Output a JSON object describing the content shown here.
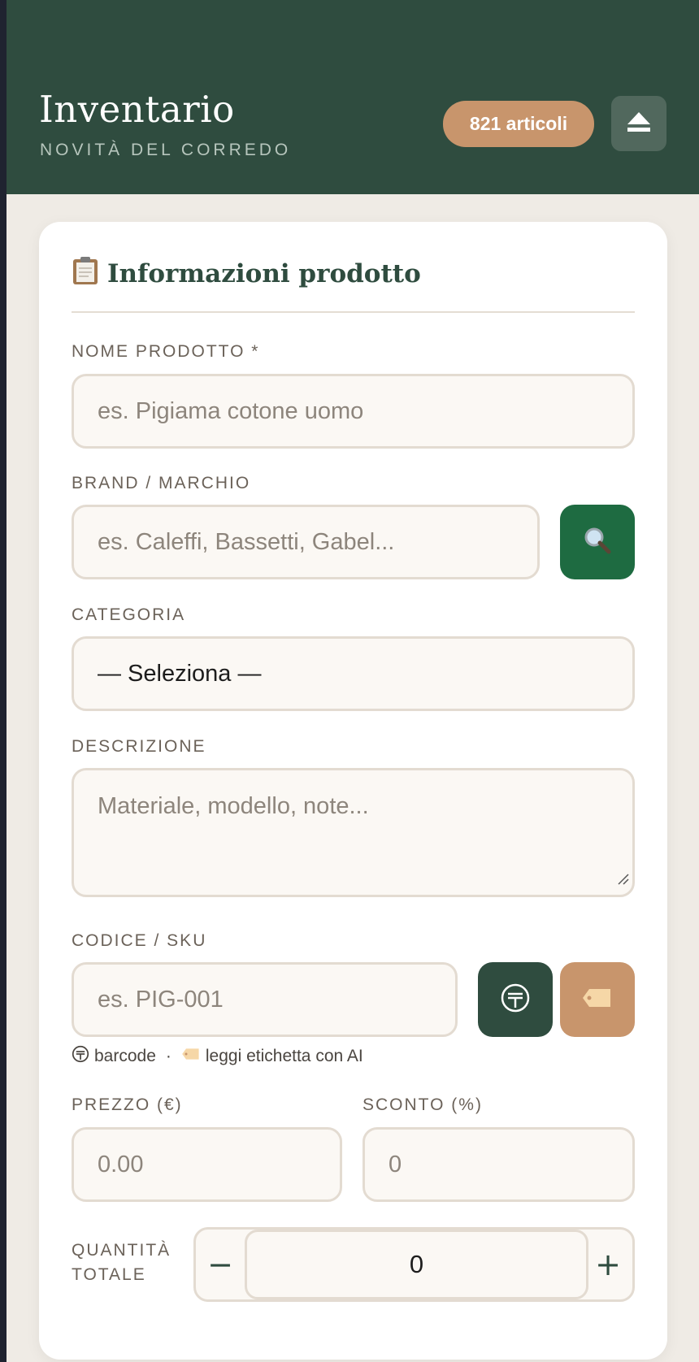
{
  "header": {
    "title": "Inventario",
    "subtitle": "NOVITÀ DEL CORREDO",
    "count_badge": "821 articoli",
    "eject_icon": "eject-icon"
  },
  "form": {
    "section_title": "Informazioni prodotto",
    "section_icon": "clipboard-icon",
    "name": {
      "label": "NOME PRODOTTO *",
      "placeholder": "es. Pigiama cotone uomo"
    },
    "brand": {
      "label": "BRAND / MARCHIO",
      "placeholder": "es. Caleffi, Bassetti, Gabel...",
      "search_icon": "search-icon"
    },
    "category": {
      "label": "CATEGORIA",
      "value": "— Seleziona —"
    },
    "description": {
      "label": "DESCRIZIONE",
      "placeholder": "Materiale, modello, note..."
    },
    "sku": {
      "label": "CODICE / SKU",
      "placeholder": "es. PIG-001",
      "barcode_icon": "barcode-icon",
      "tag_icon": "tag-icon",
      "hint_barcode": "barcode",
      "hint_separator": "·",
      "hint_ai": "leggi etichetta con AI"
    },
    "price": {
      "label": "PREZZO (€)",
      "placeholder": "0.00"
    },
    "discount": {
      "label": "SCONTO (%)",
      "placeholder": "0"
    },
    "quantity": {
      "label_line1": "QUANTITÀ",
      "label_line2": "TOTALE",
      "minus": "−",
      "plus": "+",
      "value": "0"
    }
  },
  "colors": {
    "header_bg": "#2f4c3f",
    "accent_tan": "#c8956c",
    "search_btn": "#1e6b41",
    "barcode_btn": "#2f4c3f"
  }
}
